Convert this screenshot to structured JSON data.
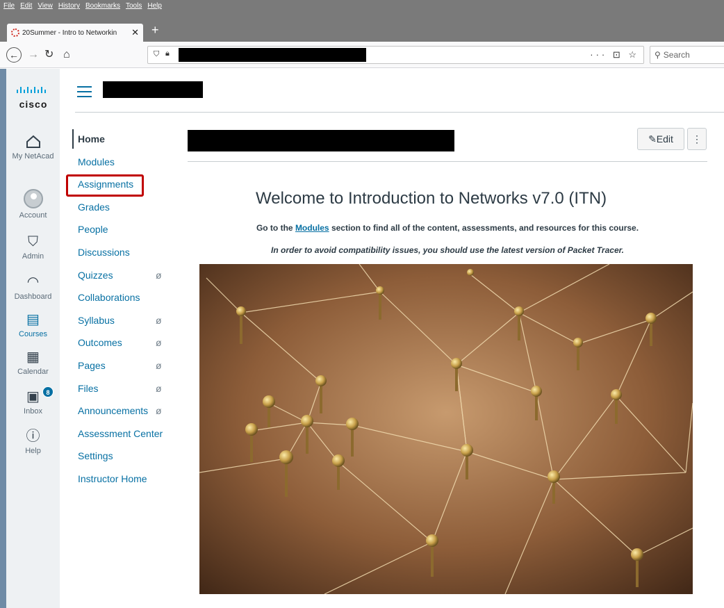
{
  "browser": {
    "menu": [
      "File",
      "Edit",
      "View",
      "History",
      "Bookmarks",
      "Tools",
      "Help"
    ],
    "tab_title": "20Summer - Intro to Networkin",
    "search_placeholder": "Search"
  },
  "global_nav": {
    "items": [
      {
        "label": "My NetAcad",
        "icon": "home-icon"
      },
      {
        "label": "Account",
        "icon": "avatar-icon"
      },
      {
        "label": "Admin",
        "icon": "shield-icon"
      },
      {
        "label": "Dashboard",
        "icon": "dashboard-icon"
      },
      {
        "label": "Courses",
        "icon": "book-icon"
      },
      {
        "label": "Calendar",
        "icon": "calendar-icon"
      },
      {
        "label": "Inbox",
        "icon": "inbox-icon",
        "badge": "8"
      },
      {
        "label": "Help",
        "icon": "help-icon"
      }
    ],
    "logo_text": "cisco",
    "active": "Courses",
    "accent": "#0770a3"
  },
  "course_nav": {
    "items": [
      {
        "label": "Home",
        "hidden": false
      },
      {
        "label": "Modules",
        "hidden": false
      },
      {
        "label": "Assignments",
        "hidden": false
      },
      {
        "label": "Grades",
        "hidden": false
      },
      {
        "label": "People",
        "hidden": false
      },
      {
        "label": "Discussions",
        "hidden": false
      },
      {
        "label": "Quizzes",
        "hidden": true
      },
      {
        "label": "Collaborations",
        "hidden": false
      },
      {
        "label": "Syllabus",
        "hidden": true
      },
      {
        "label": "Outcomes",
        "hidden": true
      },
      {
        "label": "Pages",
        "hidden": true
      },
      {
        "label": "Files",
        "hidden": true
      },
      {
        "label": "Announcements",
        "hidden": true
      },
      {
        "label": "Assessment Center",
        "hidden": false
      },
      {
        "label": "Settings",
        "hidden": false
      },
      {
        "label": "Instructor Home",
        "hidden": false
      }
    ],
    "highlighted": "Assignments"
  },
  "content": {
    "edit_label": "Edit",
    "kebab_label": "⋮",
    "welcome": "Welcome to Introduction to Networks v7.0 (ITN)",
    "line1_before": "Go to the ",
    "line1_link": "Modules",
    "line1_after": " section to find all of the content, assessments, and resources for this course.",
    "line2": "In order to avoid compatibility issues, you should use the latest version of Packet Tracer."
  }
}
